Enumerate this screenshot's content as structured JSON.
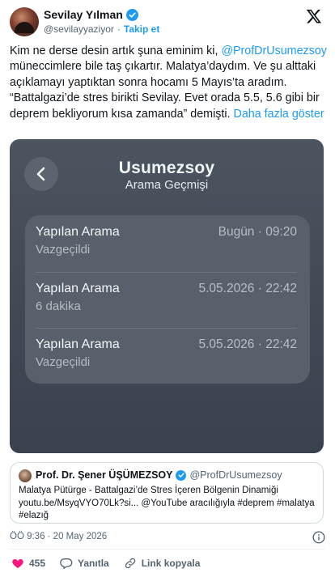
{
  "author": {
    "name": "Sevilay Yılman",
    "handle": "@sevilayyaziyor",
    "follow_label": "Takip et"
  },
  "tweet": {
    "line1": "Kim ne derse desin artık şuna eminim ki,",
    "mention": "@ProfDrUsumezsoy",
    "line2_rest": " müneccimlere bile taş çıkartır. Malatya’daydım. Ve şu alttaki açıklamayı yaptıktan sonra hocamı 5 Mayıs’ta aradım. “Battalgazi’de stres birikti Sevilay. Evet orada 5.5, 5.6 gibi bir deprem bekliyorum kısa zamanda” demişti.",
    "show_more": "Daha fazla göster"
  },
  "screenshot": {
    "title": "Usumezsoy",
    "subtitle": "Arama Geçmişi",
    "calls": [
      {
        "kind": "Yapılan Arama",
        "detail": "Vazgeçildi",
        "when": "Bugün · 09:20"
      },
      {
        "kind": "Yapılan Arama",
        "detail": "6 dakika",
        "when": "5.05.2026 · 22:42"
      },
      {
        "kind": "Yapılan Arama",
        "detail": "Vazgeçildi",
        "when": "5.05.2026 · 22:42"
      }
    ]
  },
  "quote": {
    "name": "Prof. Dr. Şener ÜŞÜMEZSOY",
    "handle": "@ProfDrUsumezsoy",
    "line1": "Malatya Pütürge - Battalgazi’de Stres İçeren Bölgenin Dinamiği",
    "line2": "youtu.be/MsyqVYO70Lk?si... @YouTube aracılığıyla #deprem #malatya",
    "line3": "#elazığ"
  },
  "meta": {
    "time_date": "ÖÖ 9:36 · 20 May 2026"
  },
  "actions": {
    "likes": "455",
    "reply_label": "Yanıtla",
    "copy_link_label": "Link kopyala"
  },
  "colors": {
    "accent": "#1d9bf0",
    "like": "#f91880",
    "text": "#0f1419",
    "muted": "#536471"
  }
}
